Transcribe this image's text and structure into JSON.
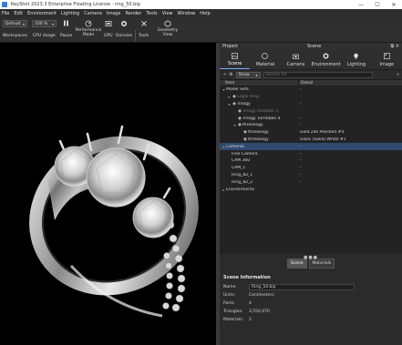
{
  "window": {
    "title": "KeyShot 2023.3 Enterprise Floating License - ring_50.bip",
    "minimize": "—",
    "maximize": "☐",
    "close": "✕"
  },
  "menu": [
    "File",
    "Edit",
    "Environment",
    "Lighting",
    "Camera",
    "Image",
    "Render",
    "Tools",
    "View",
    "Window",
    "Help"
  ],
  "toolbar": {
    "workspace_value": "Default",
    "zoom_value": "100 %",
    "buttons": [
      {
        "label": "Workspaces",
        "icon": "workspaces-icon"
      },
      {
        "label": "CPU Usage",
        "icon": "cpu-icon"
      },
      {
        "label": "Pause",
        "icon": "pause-icon"
      },
      {
        "label": "Performance Mode",
        "icon": "performance-icon"
      },
      {
        "label": "GPU",
        "icon": "gpu-icon"
      },
      {
        "label": "Denoise",
        "icon": "denoise-icon"
      },
      {
        "label": "Tools",
        "icon": "tools-icon"
      },
      {
        "label": "Geometry View",
        "icon": "geometry-view-icon"
      }
    ]
  },
  "panel": {
    "project_label": "Project",
    "scene_label": "Scene",
    "tabs": [
      {
        "label": "Scene",
        "icon": "scene-icon",
        "active": true
      },
      {
        "label": "Material",
        "icon": "material-icon",
        "active": false
      },
      {
        "label": "Camera",
        "icon": "camera-icon",
        "active": false
      },
      {
        "label": "Environment",
        "icon": "environment-icon",
        "active": false
      },
      {
        "label": "Lighting",
        "icon": "lighting-icon",
        "active": false
      },
      {
        "label": "Image",
        "icon": "image-icon",
        "active": false
      }
    ],
    "show_dropdown": "Show",
    "search_placeholder": "Search All",
    "columns": {
      "item": "Item",
      "detail": "Detail"
    },
    "tree": [
      {
        "indent": 0,
        "arrow": "▾",
        "eye": "",
        "label": "Model Sets",
        "detail": "-",
        "dim": false
      },
      {
        "indent": 1,
        "arrow": "▸",
        "eye": "◉",
        "label": "Eagle Ring",
        "detail": "-",
        "dim": true
      },
      {
        "indent": 1,
        "arrow": "▾",
        "eye": "◉",
        "label": "Trilogy",
        "detail": "-",
        "dim": false
      },
      {
        "indent": 2,
        "arrow": "",
        "eye": "◉",
        "label": "Trilogy Rotation 3",
        "detail": "-",
        "dim": true
      },
      {
        "indent": 2,
        "arrow": "",
        "eye": "◉",
        "label": "Trilogy Turntable 4",
        "detail": "-",
        "dim": false
      },
      {
        "indent": 2,
        "arrow": "▾",
        "eye": "◉",
        "label": "threeilogy",
        "detail": "-",
        "dim": false
      },
      {
        "indent": 3,
        "arrow": "",
        "eye": "◉",
        "label": "threeilogy",
        "detail": "Gold 24k Polished #4",
        "dim": false
      },
      {
        "indent": 3,
        "arrow": "",
        "eye": "◉",
        "label": "threeilogy",
        "detail": "Glass (Solid) White #1",
        "dim": false
      },
      {
        "indent": 0,
        "arrow": "▾",
        "eye": "",
        "label": "Cameras",
        "detail": "-",
        "dim": false,
        "selected": true
      },
      {
        "indent": 1,
        "arrow": "",
        "eye": "",
        "label": "Free Camera",
        "detail": "-",
        "dim": false
      },
      {
        "indent": 1,
        "arrow": "",
        "eye": "",
        "label": "CAM 360",
        "detail": "-",
        "dim": false
      },
      {
        "indent": 1,
        "arrow": "",
        "eye": "",
        "label": "CAM_1",
        "detail": "-",
        "dim": false
      },
      {
        "indent": 1,
        "arrow": "",
        "eye": "",
        "label": "Ring_82_1",
        "detail": "-",
        "dim": false
      },
      {
        "indent": 1,
        "arrow": "",
        "eye": "",
        "label": "Ring_82_2",
        "detail": "-",
        "dim": false
      },
      {
        "indent": 0,
        "arrow": "▸",
        "eye": "",
        "label": "Environments",
        "detail": "",
        "dim": false
      }
    ],
    "bottom_tabs": [
      {
        "label": "Scene",
        "active": true
      },
      {
        "label": "Materials",
        "active": false
      }
    ],
    "info": {
      "title": "Scene Information",
      "rows": [
        {
          "key": "Name:",
          "value": "Ring_50.bip"
        },
        {
          "key": "Units:",
          "value": "Centimeters"
        },
        {
          "key": "Parts:",
          "value": "4"
        },
        {
          "key": "Triangles:",
          "value": "3,550,070"
        },
        {
          "key": "Materials:",
          "value": "2"
        }
      ]
    }
  }
}
